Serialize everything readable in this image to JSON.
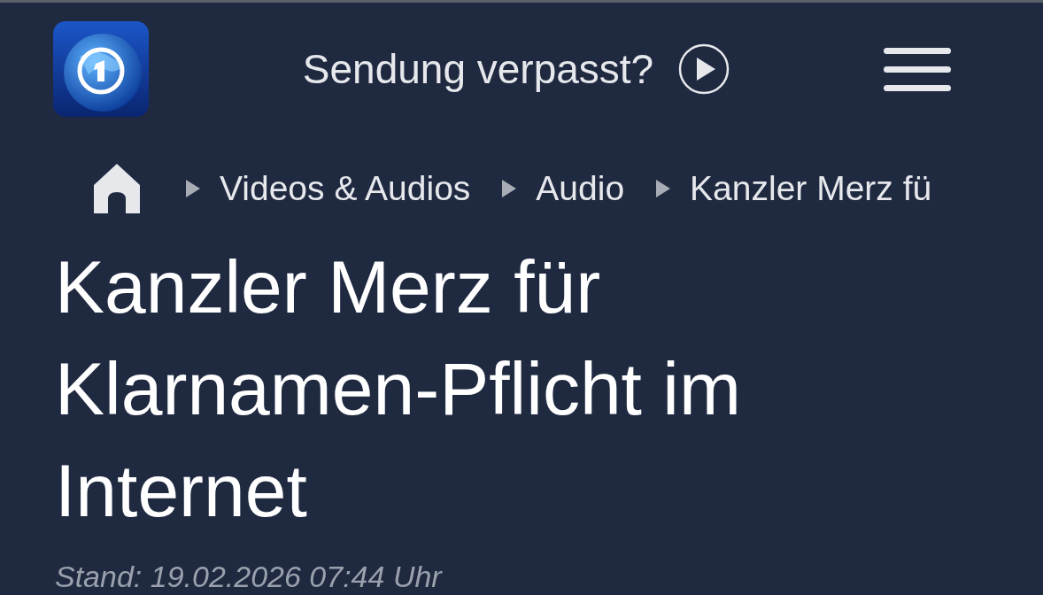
{
  "header": {
    "missed_show": "Sendung verpasst?"
  },
  "breadcrumb": [
    {
      "label": "Videos & Audios"
    },
    {
      "label": "Audio"
    },
    {
      "label": "Kanzler Merz fü"
    }
  ],
  "article": {
    "title": "Kanzler Merz für Klarnamen-Pflicht im Internet",
    "timestamp": "Stand: 19.02.2026 07:44 Uhr"
  }
}
